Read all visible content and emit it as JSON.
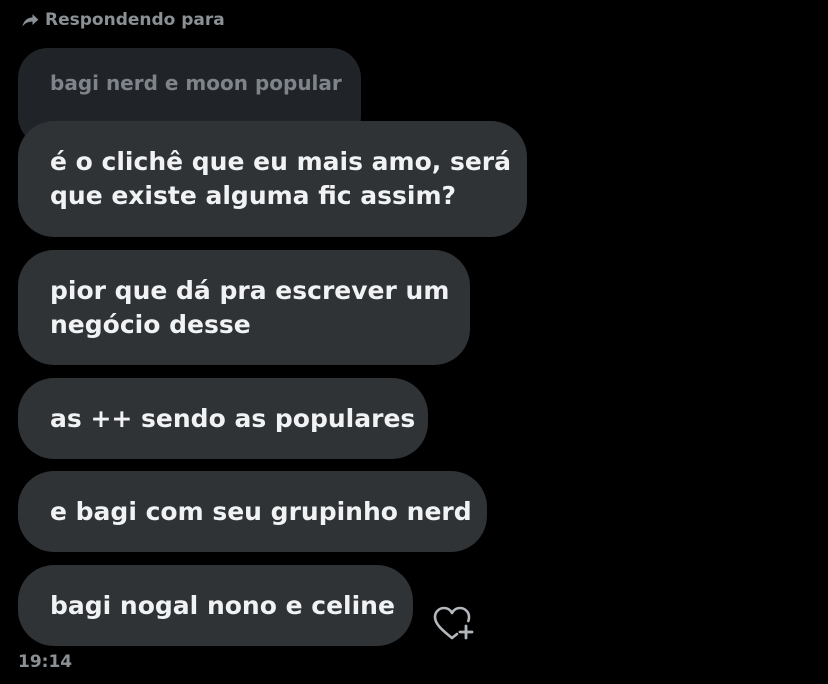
{
  "reply_header": {
    "icon": "reply-arrow-icon",
    "label": "Respondendo para"
  },
  "quoted_message": {
    "text": "bagi nerd e moon popular"
  },
  "messages": [
    {
      "lines": [
        "é o clichê que eu mais amo, será",
        "que existe alguma fic assim?"
      ]
    },
    {
      "lines": [
        "pior que dá pra escrever um",
        "negócio desse"
      ]
    },
    {
      "lines": [
        "as ++ sendo as populares"
      ]
    },
    {
      "lines": [
        "e bagi com seu grupinho nerd"
      ]
    },
    {
      "lines": [
        "bagi nogal nono e celine"
      ]
    }
  ],
  "reaction_button": {
    "icon": "heart-plus-icon"
  },
  "timestamp": "19:14",
  "colors": {
    "background": "#000000",
    "bubble": "#2f3336",
    "quoted_bubble": "#202327",
    "text": "#f1f2f3",
    "muted_text": "#8b9095"
  }
}
